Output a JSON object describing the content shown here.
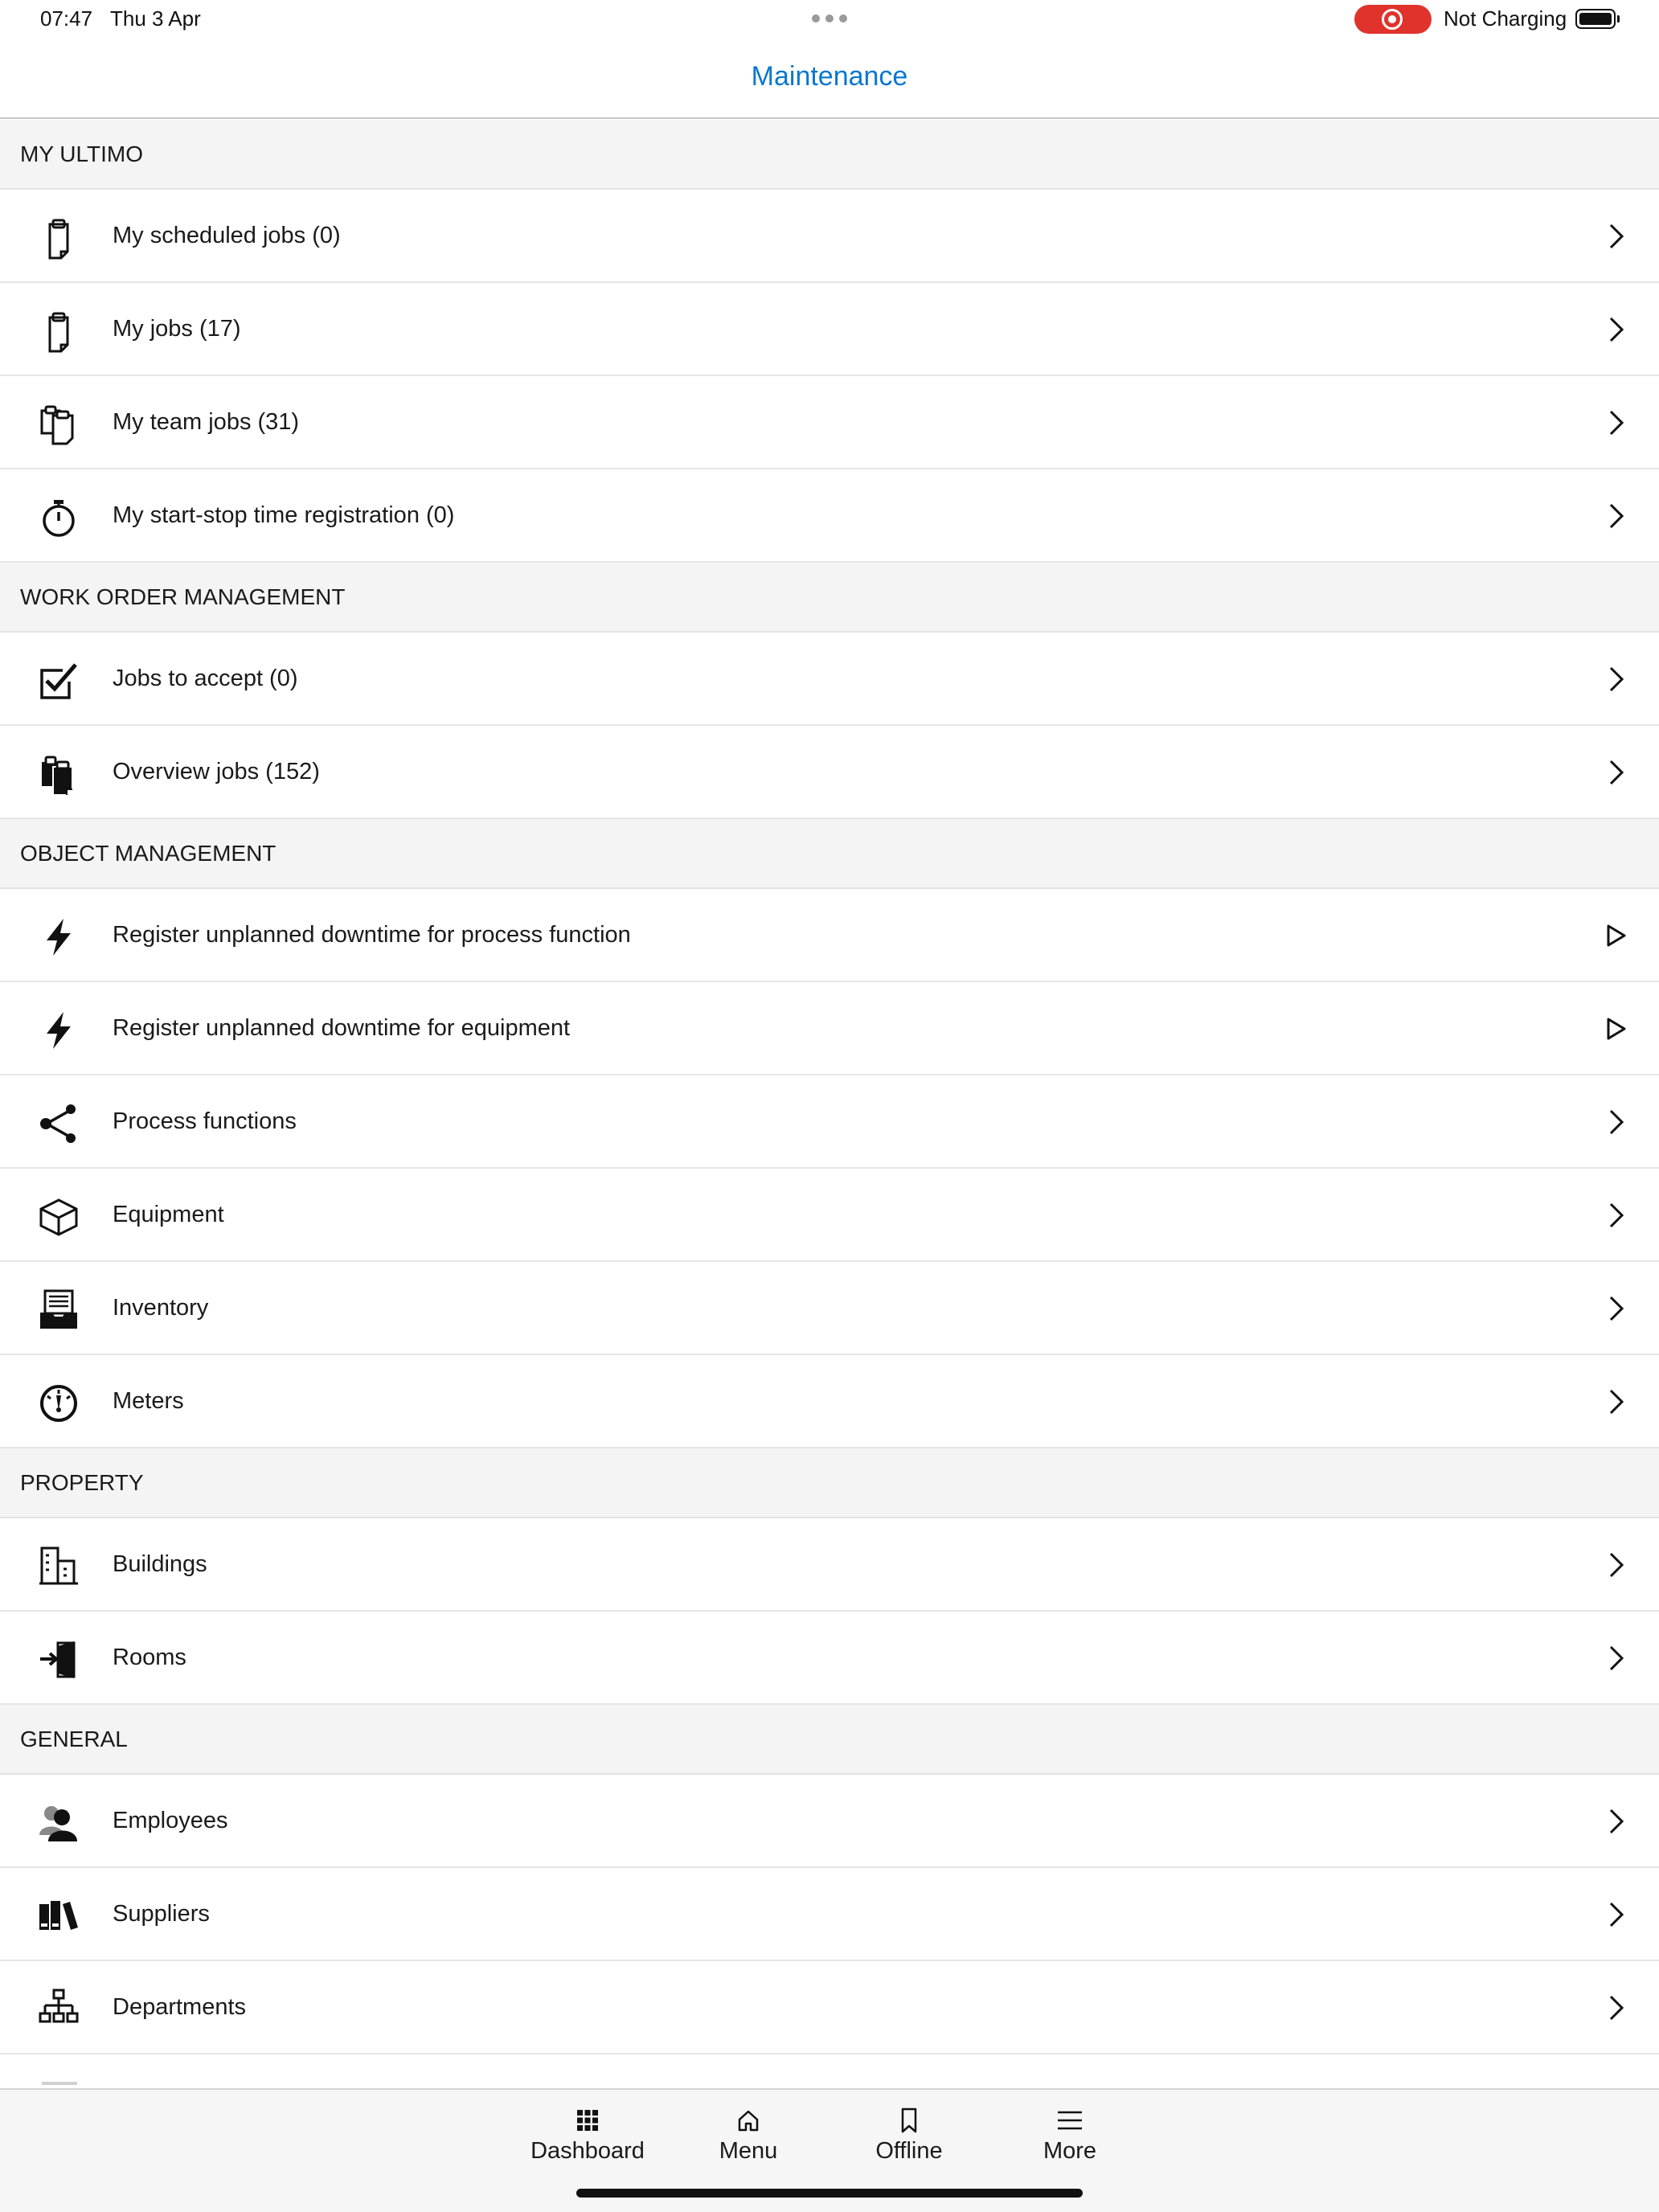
{
  "status_bar": {
    "time": "07:47",
    "date": "Thu 3 Apr",
    "charging": "Not Charging",
    "record_color": "#e0332c"
  },
  "header": {
    "title": "Maintenance",
    "title_color": "#0a77d1"
  },
  "sections": [
    {
      "title": "MY ULTIMO",
      "items": [
        {
          "label": "My scheduled jobs (0)",
          "icon": "clipboard-icon",
          "action": "chevron"
        },
        {
          "label": "My jobs (17)",
          "icon": "clipboard-icon",
          "action": "chevron"
        },
        {
          "label": "My team jobs (31)",
          "icon": "clipboards-icon",
          "action": "chevron"
        },
        {
          "label": "My start-stop time registration (0)",
          "icon": "stopwatch-icon",
          "action": "chevron"
        }
      ]
    },
    {
      "title": "WORK ORDER MANAGEMENT",
      "items": [
        {
          "label": "Jobs to accept (0)",
          "icon": "checkbox-icon",
          "action": "chevron"
        },
        {
          "label": "Overview jobs (152)",
          "icon": "clipboards-filled-icon",
          "action": "chevron"
        }
      ]
    },
    {
      "title": "OBJECT MANAGEMENT",
      "items": [
        {
          "label": "Register unplanned downtime for process function",
          "icon": "lightning-icon",
          "action": "play"
        },
        {
          "label": "Register unplanned downtime for equipment",
          "icon": "lightning-icon",
          "action": "play"
        },
        {
          "label": "Process functions",
          "icon": "share-icon",
          "action": "chevron"
        },
        {
          "label": "Equipment",
          "icon": "cube-icon",
          "action": "chevron"
        },
        {
          "label": "Inventory",
          "icon": "inbox-tray-icon",
          "action": "chevron"
        },
        {
          "label": "Meters",
          "icon": "gauge-icon",
          "action": "chevron"
        }
      ]
    },
    {
      "title": "PROPERTY",
      "items": [
        {
          "label": "Buildings",
          "icon": "buildings-icon",
          "action": "chevron"
        },
        {
          "label": "Rooms",
          "icon": "door-enter-icon",
          "action": "chevron"
        }
      ]
    },
    {
      "title": "GENERAL",
      "items": [
        {
          "label": "Employees",
          "icon": "people-icon",
          "action": "chevron"
        },
        {
          "label": "Suppliers",
          "icon": "binders-icon",
          "action": "chevron"
        },
        {
          "label": "Departments",
          "icon": "org-chart-icon",
          "action": "chevron"
        }
      ]
    }
  ],
  "tab_bar": {
    "tabs": [
      {
        "label": "Dashboard",
        "icon": "grid-icon"
      },
      {
        "label": "Menu",
        "icon": "home-icon"
      },
      {
        "label": "Offline",
        "icon": "bookmark-icon"
      },
      {
        "label": "More",
        "icon": "hamburger-icon"
      }
    ]
  }
}
